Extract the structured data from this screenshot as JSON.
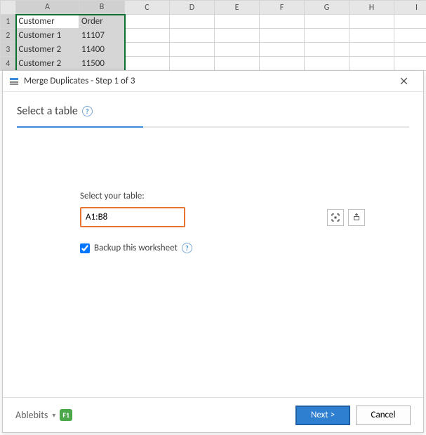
{
  "sheet": {
    "columns": [
      "A",
      "B",
      "C",
      "D",
      "E",
      "F",
      "G",
      "H",
      "I"
    ],
    "rows": [
      {
        "n": "1",
        "A": "Customer",
        "B": "Order"
      },
      {
        "n": "2",
        "A": "Customer 1",
        "B": "11107"
      },
      {
        "n": "3",
        "A": "Customer 2",
        "B": "11400"
      },
      {
        "n": "4",
        "A": "Customer 2",
        "B": "11500"
      }
    ]
  },
  "dialog": {
    "title": "Merge Duplicates - Step 1 of 3",
    "heading": "Select a table",
    "field_label": "Select your table:",
    "range_value": "A1:B8",
    "backup_label": "Backup this worksheet",
    "backup_checked": true,
    "brand": "Ablebits",
    "f1_label": "F1",
    "next_label": "Next >",
    "cancel_label": "Cancel"
  }
}
